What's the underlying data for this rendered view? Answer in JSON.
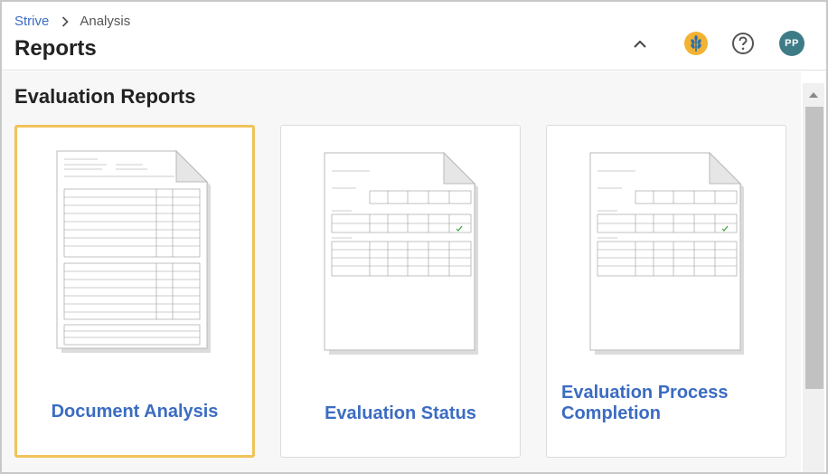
{
  "breadcrumb": {
    "root": "Strive",
    "current": "Analysis"
  },
  "page": {
    "title": "Reports"
  },
  "header": {
    "avatar_initials": "PP"
  },
  "section": {
    "title": "Evaluation Reports"
  },
  "cards": [
    {
      "label": "Document Analysis",
      "selected": true
    },
    {
      "label": "Evaluation Status",
      "selected": false
    },
    {
      "label": "Evaluation Process Completion",
      "selected": false
    }
  ],
  "colors": {
    "accent": "#3b6cc2",
    "selected_border": "#f0c35a",
    "avatar_bg": "#3d7c86",
    "logo_bg": "#f2b233"
  }
}
